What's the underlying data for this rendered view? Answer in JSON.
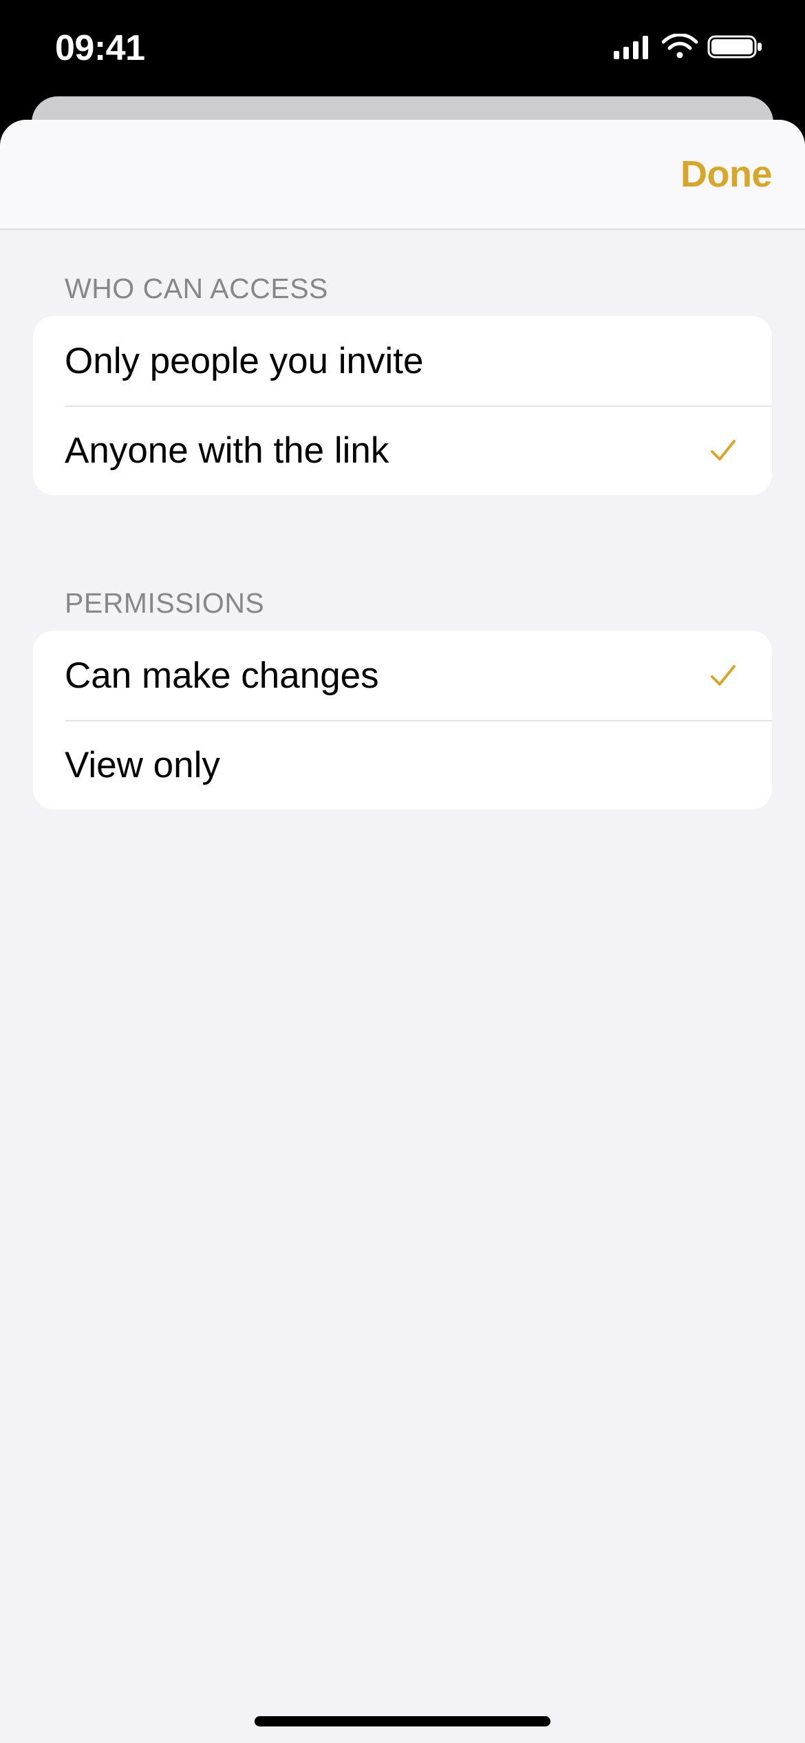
{
  "statusbar": {
    "time": "09:41"
  },
  "nav": {
    "done": "Done"
  },
  "sections": {
    "access": {
      "header": "WHO CAN ACCESS",
      "options": [
        {
          "label": "Only people you invite",
          "selected": false
        },
        {
          "label": "Anyone with the link",
          "selected": true
        }
      ]
    },
    "permissions": {
      "header": "PERMISSIONS",
      "options": [
        {
          "label": "Can make changes",
          "selected": true
        },
        {
          "label": "View only",
          "selected": false
        }
      ]
    }
  },
  "colors": {
    "accent": "#d6a72a",
    "sheet_bg": "#f3f2f7",
    "row_bg": "#ffffff"
  }
}
